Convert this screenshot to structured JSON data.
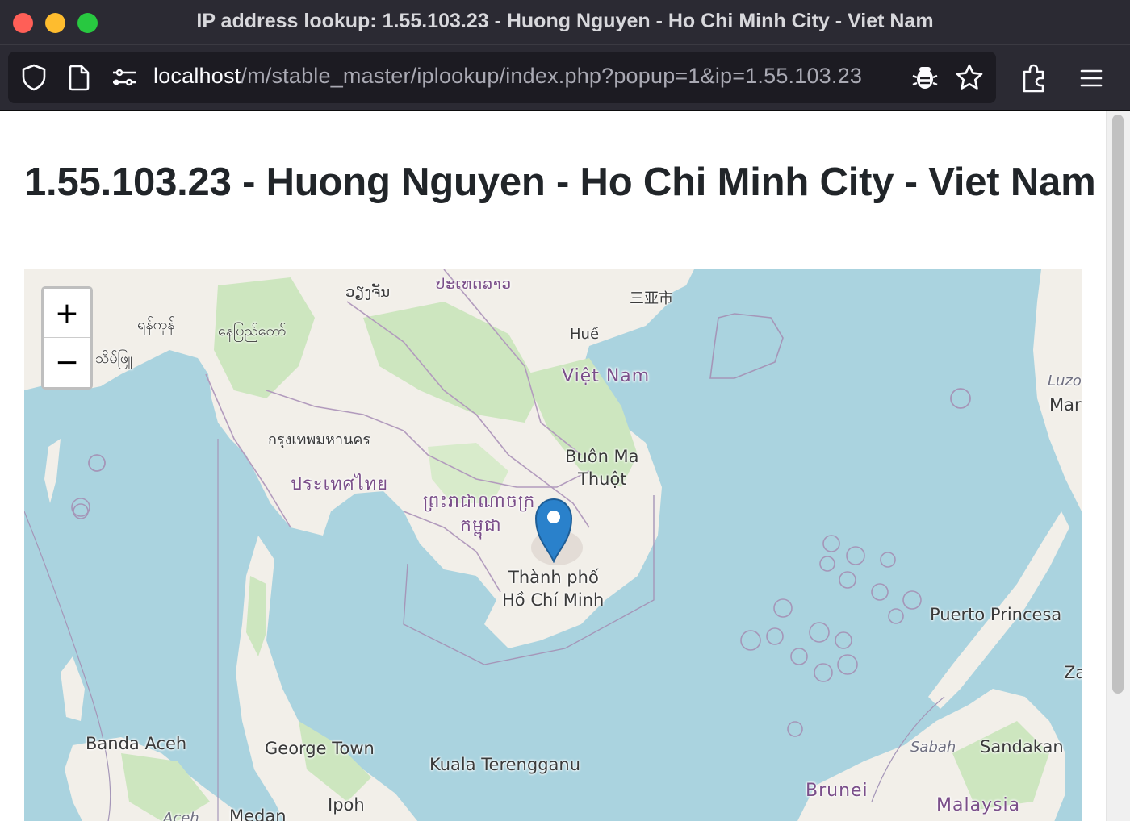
{
  "window": {
    "title": "IP address lookup: 1.55.103.23 - Huong Nguyen - Ho Chi Minh City - Viet Nam"
  },
  "toolbar": {
    "url_host": "localhost",
    "url_path": "/m/stable_master/iplookup/index.php?popup=1&ip=1.55.103.23",
    "icons": [
      "shield-icon",
      "page-icon",
      "permissions-icon",
      "bug-icon",
      "bookmark-star-icon",
      "extensions-icon",
      "menu-icon"
    ]
  },
  "page": {
    "title": "1.55.103.23 - Huong Nguyen - Ho Chi Minh City - Viet Nam"
  },
  "map": {
    "zoom_in": "+",
    "zoom_out": "−",
    "labels": {
      "vientiane": "ວຽງຈັນ",
      "laos": "ປະເທດລາວ",
      "sanya": "三亚市",
      "hue": "Huế",
      "vietnam": "Việt Nam",
      "naypyidaw": "နေပြည်တော်",
      "yangon": "ရန်ကုန်",
      "myanmar": "သိမ်ဖြူ",
      "bangkok": "กรุงเทพมหานคร",
      "thailand": "ประเทศไทย",
      "buon_ma_thuot_1": "Buôn Ma",
      "buon_ma_thuot_2": "Thuột",
      "cambodia_1": "ព្រះរាជាណាចក្រ",
      "cambodia_2": "កម្ពុជា",
      "hcmc_1": "Thành phố",
      "hcmc_2": "Hồ Chí Minh",
      "luzon": "Luzo",
      "manila": "Mar",
      "puerto_princesa": "Puerto Princesa",
      "zamboanga": "Za",
      "banda_aceh": "Banda Aceh",
      "george_town": "George Town",
      "kuala_terengganu": "Kuala Terengganu",
      "sabah": "Sabah",
      "sandakan": "Sandakan",
      "brunei": "Brunei",
      "malaysia": "Malaysia",
      "ipoh": "Ipoh",
      "medan": "Medan",
      "aceh": "Aceh"
    },
    "marker": "map-marker-icon"
  },
  "colors": {
    "chrome": "#2b2a33",
    "urlbar": "#1c1b22",
    "water": "#aad3df",
    "land": "#f2efe9",
    "forest": "#add19e",
    "marker": "#2a81cb"
  }
}
